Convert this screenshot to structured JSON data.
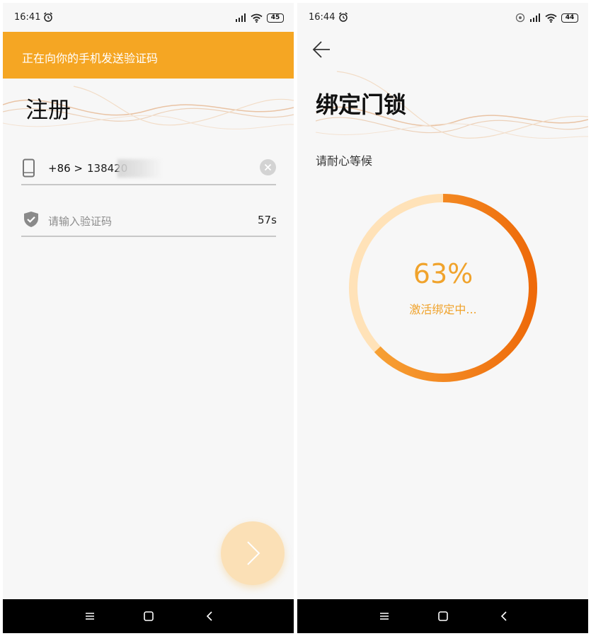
{
  "left_screen": {
    "status": {
      "time": "16:41",
      "battery": "45"
    },
    "banner": {
      "text": "正在向你的手机发送验证码"
    },
    "title": "注册",
    "phone_field": {
      "country_code": "+86 >",
      "number": "138420"
    },
    "code_field": {
      "placeholder": "请输入验证码",
      "countdown": "57s"
    }
  },
  "right_screen": {
    "status": {
      "time": "16:44",
      "battery": "44"
    },
    "title": "绑定门锁",
    "subtitle": "请耐心等候",
    "progress": {
      "percent_label": "63%",
      "value": 0.63,
      "status_text": "激活绑定中..."
    }
  },
  "colors": {
    "accent": "#f5a623",
    "accent_dark": "#ef6c00",
    "ring_track": "#ffe2b8",
    "fab": "#fbe0b6",
    "progress_text": "#f0a32c"
  }
}
